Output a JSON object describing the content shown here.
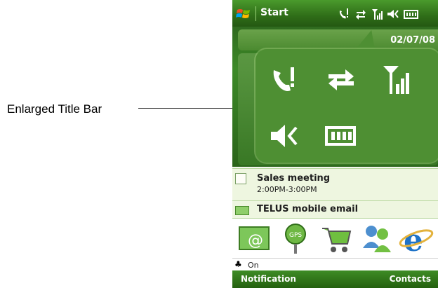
{
  "annotation": {
    "label": "Enlarged Title Bar"
  },
  "titlebar": {
    "start_label": "Start"
  },
  "today": {
    "date": "02/07/08"
  },
  "appointment": {
    "title": "Sales meeting",
    "time": "2:00PM-3:00PM"
  },
  "email": {
    "title": "TELUS mobile email"
  },
  "apps": [
    {
      "name": "email-app"
    },
    {
      "name": "gps-app"
    },
    {
      "name": "shop-app"
    },
    {
      "name": "contacts-app"
    },
    {
      "name": "internet-explorer"
    }
  ],
  "partial_item": {
    "text": "On"
  },
  "softkeys": {
    "left": "Notification",
    "right": "Contacts"
  },
  "status_icons": [
    "missed-call-icon",
    "data-sync-icon",
    "signal-strength-icon",
    "volume-mute-icon",
    "battery-icon"
  ],
  "colors": {
    "titlebar": "#2f6d18",
    "bubble": "#4e8f33",
    "accent_white": "#ffffff"
  }
}
